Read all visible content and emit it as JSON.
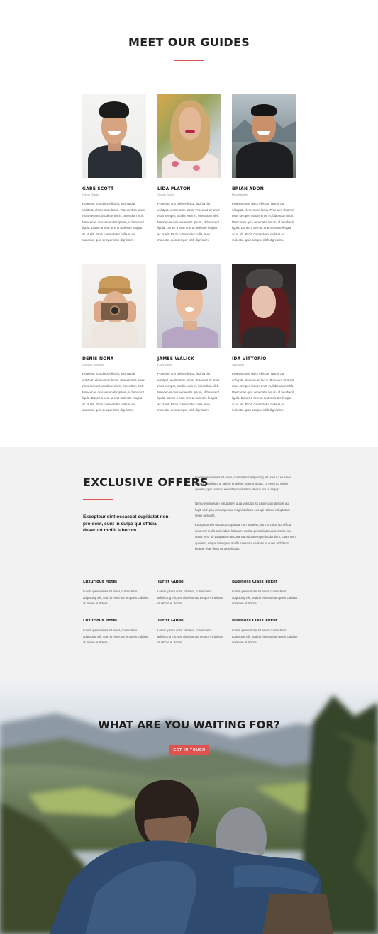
{
  "guides_section": {
    "title": "MEET OUR GUIDES",
    "guides": [
      {
        "name": "GABE SCOTT",
        "role": "Hiking Guide",
        "bio": "Praesent non dolor efficitur, lacinia dui volutpat, elementum lacus. Praesent sit amet risus semper, iaculis enim in, bibendum nibh. Maecenas quis venenatis ipsum, id hendrerit ligula. Donec a sem ut erat molestie feugiat ac ut elit. Proin consectetur nulla et ex molestie, quis semper nibh dignissim."
      },
      {
        "name": "LIDA PLATON",
        "role": "Ocean Guide",
        "bio": "Praesent non dolor efficitur, lacinia dui volutpat, elementum lacus. Praesent sit amet risus semper, iaculis enim in, bibendum nibh. Maecenas quis venenatis ipsum, id hendrerit ligula. Donec a sem ut erat molestie feugiat ac ut elit. Proin consectetur nulla et ex molestie, quis semper nibh dignissim."
      },
      {
        "name": "BRIAN ADON",
        "role": "Mountaineer",
        "bio": "Praesent non dolor efficitur, lacinia dui volutpat, elementum lacus. Praesent sit amet risus semper, iaculis enim in, bibendum nibh. Maecenas quis venenatis ipsum, id hendrerit ligula. Donec a sem ut erat molestie feugiat ac ut elit. Proin consectetur nulla et ex molestie, quis semper nibh dignissim."
      },
      {
        "name": "DENIS NONA",
        "role": "Outdoor Survival",
        "bio": "Praesent non dolor efficitur, lacinia dui volutpat, elementum lacus. Praesent sit amet risus semper, iaculis enim in, bibendum nibh. Maecenas quis venenatis ipsum, id hendrerit ligula. Donec a sem ut erat molestie feugiat ac ut elit. Proin consectetur nulla et ex molestie, quis semper nibh dignissim."
      },
      {
        "name": "JAMES WALICK",
        "role": "Food Writer",
        "bio": "Praesent non dolor efficitur, lacinia dui volutpat, elementum lacus. Praesent sit amet risus semper, iaculis enim in, bibendum nibh. Maecenas quis venenatis ipsum, id hendrerit ligula. Donec a sem ut erat molestie feugiat ac ut elit. Proin consectetur nulla et ex molestie, quis semper nibh dignissim."
      },
      {
        "name": "IDA VITTORIO",
        "role": "Skydiving",
        "bio": "Praesent non dolor efficitur, lacinia dui volutpat, elementum lacus. Praesent sit amet risus semper, iaculis enim in, bibendum nibh. Maecenas quis venenatis ipsum, id hendrerit ligula. Donec a sem ut erat molestie feugiat ac ut elit. Proin consectetur nulla et ex molestie, quis semper nibh dignissim."
      }
    ]
  },
  "offers_section": {
    "title": "EXCLUSIVE OFFERS",
    "lead": "Excepteur sint occaecat cupidatat non proident, sunt in culpa qui officia deserunt mollit laborum.",
    "paragraphs": [
      "Lorem ipsum dolor sit amet, consectetur adipiscing elit, sed do eiusmod tempor incididunt ut labore et dolore magna aliqua. Ut enim ad minim veniam, quis nostrud exercitation ullamco laboris nisi ut aliquip.",
      "Nemo enim ipsam voluptatem quia voluptas sit aspernatur aut odit aut fugit, sed quia consequuntur magni dolores eos qui ratione voluptatem sequi nesciunt.",
      "Excepteur sint occaecat cupidatat non proident, sunt in culpa qui officia deserunt mollit anim id est laborum. Sed ut perspiciatis unde omnis iste natus error sit voluptatem accusantium doloremque laudantium, totam rem aperiam, eaque ipsa quae ab illo inventore veritatis et quasi architecto beatae vitae dicta sunt explicabo."
    ],
    "features": [
      {
        "title": "Luxurious Hotel",
        "text": "Lorem ipsum dolor sit amet, consectetur adipiscing elit, sed do eiusmod tempor incididunt ut labore et dolore."
      },
      {
        "title": "Turist Guide",
        "text": "Lorem ipsum dolor sit amet, consectetur adipiscing elit, sed do eiusmod tempor incididunt ut labore et dolore."
      },
      {
        "title": "Business Class Titket",
        "text": "Lorem ipsum dolor sit amet, consectetur adipiscing elit, sed do eiusmod tempor incididunt ut labore et dolore."
      },
      {
        "title": "Luxurious Hotel",
        "text": "Lorem ipsum dolor sit amet, consectetur adipiscing elit, sed do eiusmod tempor incididunt ut labore et dolore."
      },
      {
        "title": "Turist Guide",
        "text": "Lorem ipsum dolor sit amet, consectetur adipiscing elit, sed do eiusmod tempor incididunt ut labore et dolore."
      },
      {
        "title": "Business Class Titket",
        "text": "Lorem ipsum dolor sit amet, consectetur adipiscing elit, sed do eiusmod tempor incididunt ut labore et dolore."
      }
    ]
  },
  "cta_section": {
    "title": "WHAT ARE YOU WAITING FOR?",
    "button_label": "GET IN TOUCH"
  },
  "colors": {
    "accent": "#e0524f",
    "heading": "#222222",
    "offers_background": "#f2f2f2"
  }
}
